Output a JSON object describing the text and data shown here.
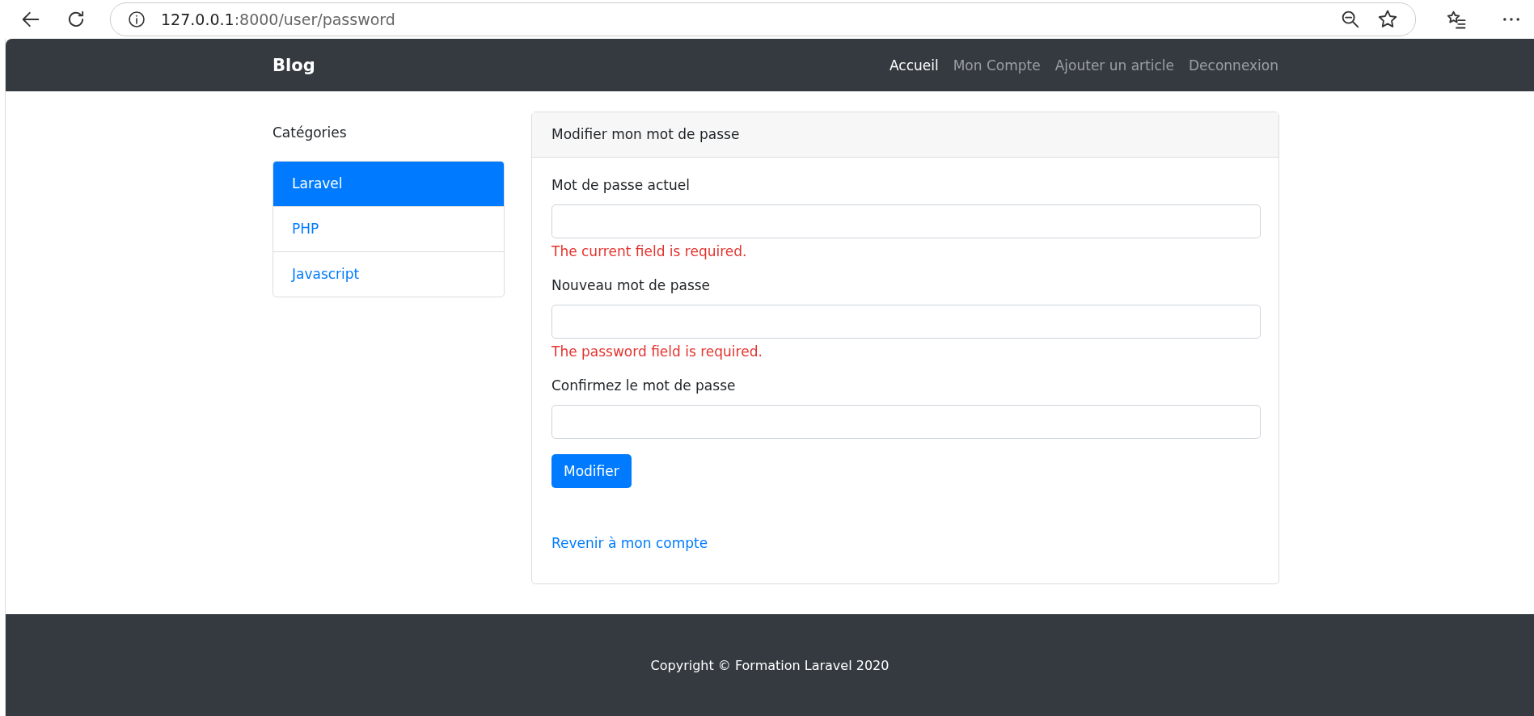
{
  "browser": {
    "url_host": "127.0.0.1",
    "url_path": ":8000/user/password"
  },
  "navbar": {
    "brand": "Blog",
    "links": [
      {
        "label": "Accueil",
        "selected": true
      },
      {
        "label": "Mon Compte",
        "selected": false
      },
      {
        "label": "Ajouter un article",
        "selected": false
      },
      {
        "label": "Deconnexion",
        "selected": false
      }
    ]
  },
  "sidebar": {
    "title": "Catégories",
    "items": [
      {
        "label": "Laravel",
        "selected": true
      },
      {
        "label": "PHP",
        "selected": false
      },
      {
        "label": "Javascript",
        "selected": false
      }
    ]
  },
  "card": {
    "header": "Modifier mon mot de passe",
    "fields": [
      {
        "label": "Mot de passe actuel",
        "error": "The current field is required."
      },
      {
        "label": "Nouveau mot de passe",
        "error": "The password field is required."
      },
      {
        "label": "Confirmez le mot de passe"
      }
    ],
    "submit": "Modifier",
    "back_link": "Revenir à mon compte"
  },
  "footer": {
    "text": "Copyright © Formation Laravel 2020"
  }
}
